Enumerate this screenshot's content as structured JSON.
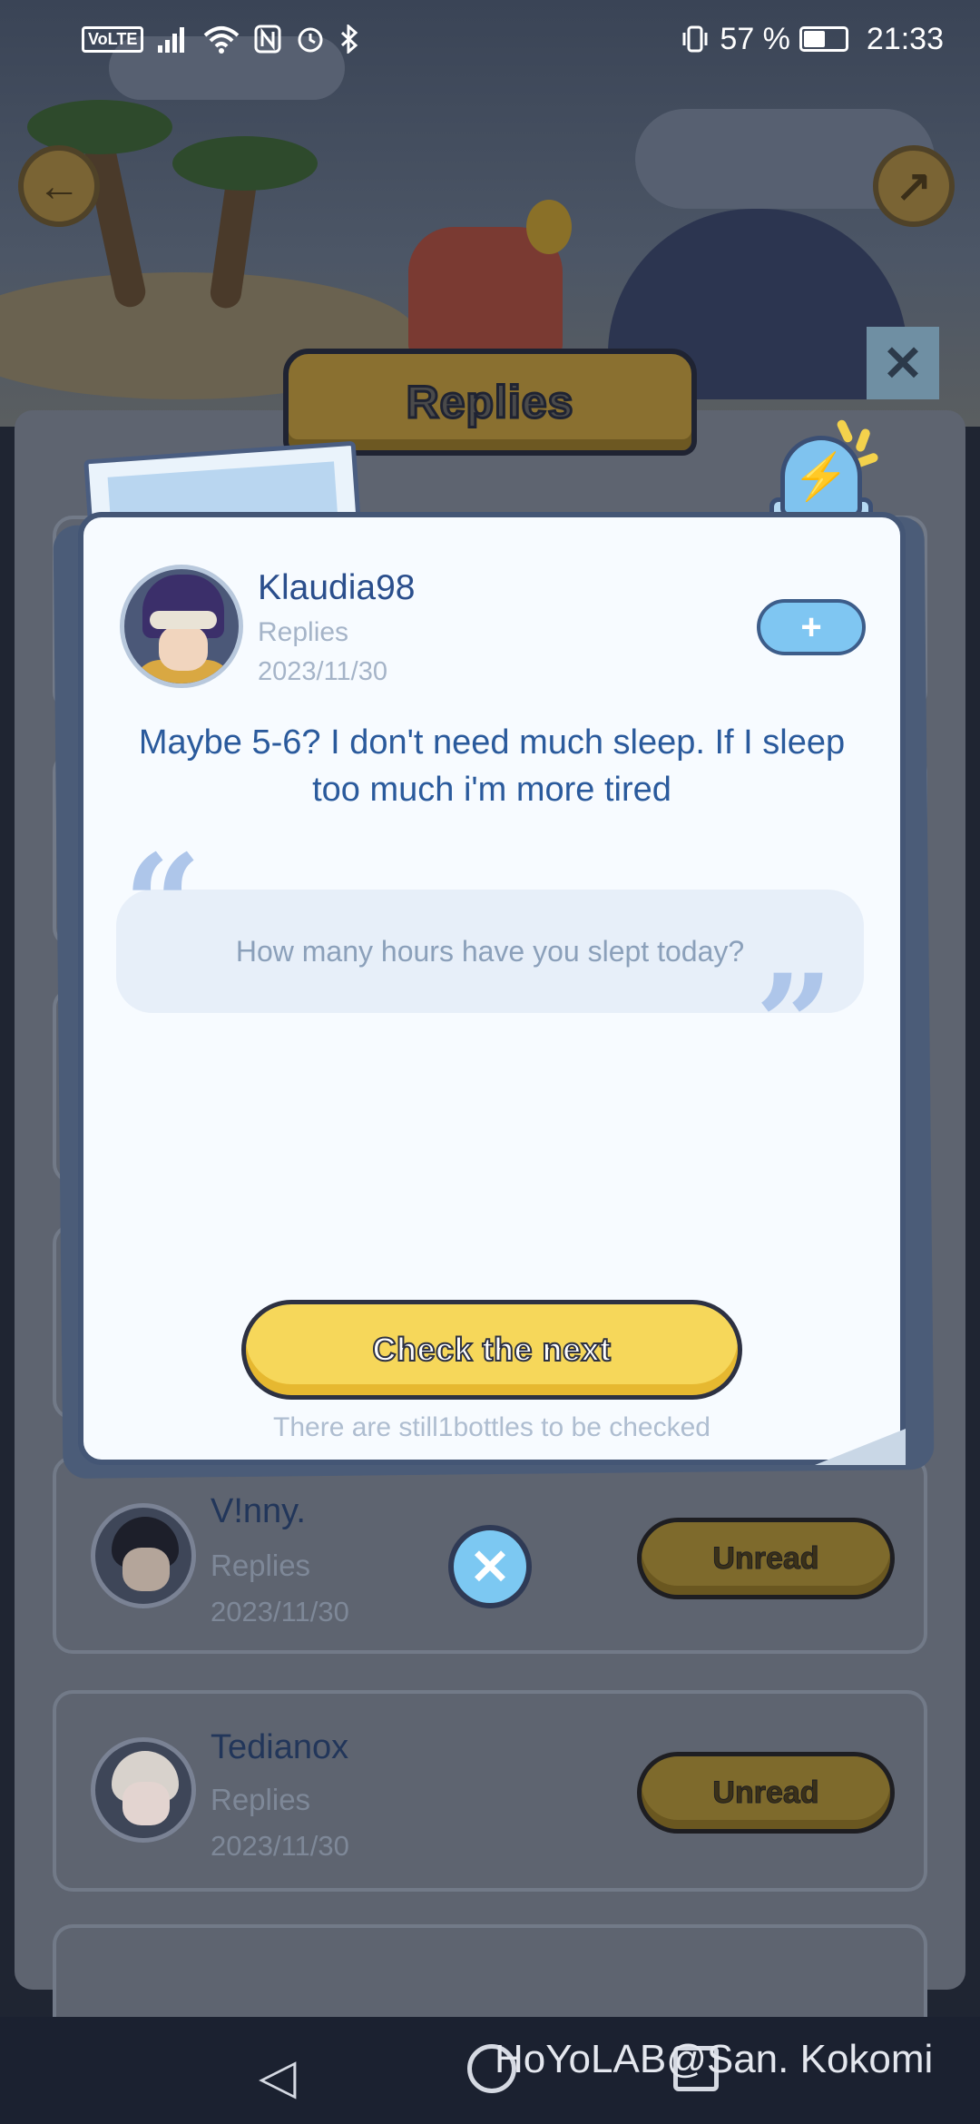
{
  "status_bar": {
    "volte": "VoLTE",
    "signal_icon": "signal-icon",
    "wifi_icon": "wifi-icon",
    "nfc_icon": "nfc-icon",
    "alarm_icon": "alarm-icon",
    "bluetooth_icon": "bluetooth-icon",
    "vibrate_icon": "vibrate-icon",
    "battery_percent": "57 %",
    "battery_level": 0.57,
    "time": "21:33"
  },
  "header": {
    "title": "Replies",
    "back_glyph": "←",
    "share_glyph": "↗",
    "sticky_close_glyph": "✕"
  },
  "popup": {
    "username": "Klaudia98",
    "type": "Replies",
    "date": "2023/11/30",
    "follow_glyph": "+",
    "siren_glyph": "⚡",
    "message": "Maybe 5-6? I don't need much sleep. If I sleep too much i'm more tired",
    "quote_open": "“",
    "quote_close": "”",
    "question": "How many hours have you slept today?",
    "next_button": "Check the next",
    "remaining": "There are still1bottles to be checked",
    "close_glyph": "✕"
  },
  "list": {
    "items": [
      {
        "name": "V!nny.",
        "type": "Replies",
        "date": "2023/11/30",
        "button": "Unread"
      },
      {
        "name": "Tedianox",
        "type": "Replies",
        "date": "2023/11/30",
        "button": "Unread"
      }
    ]
  },
  "nav": {
    "back_glyph": "◁",
    "watermark": "HoYoLAB@San. Kokomi"
  },
  "colors": {
    "accent_yellow": "#f6d75a",
    "accent_blue": "#7fc6f2",
    "message_blue": "#2a5a9c"
  }
}
